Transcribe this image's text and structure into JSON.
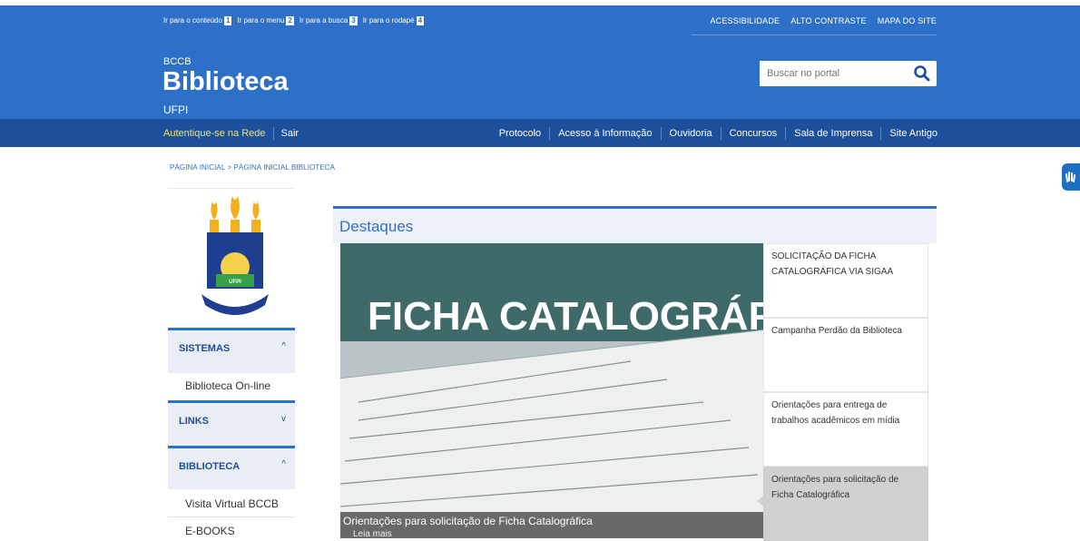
{
  "accessibility_links": [
    {
      "label": "Ir para o conteúdo",
      "num": "1"
    },
    {
      "label": "Ir para o menu",
      "num": "2"
    },
    {
      "label": "Ir para a busca",
      "num": "3"
    },
    {
      "label": "Ir para o rodapé",
      "num": "4"
    }
  ],
  "top_right_links": [
    "ACESSIBILIDADE",
    "ALTO CONTRASTE",
    "MAPA DO SITE"
  ],
  "brand": {
    "sub": "BCCB",
    "title": "Biblioteca",
    "bottom": "UFPI"
  },
  "search": {
    "placeholder": "Buscar no portal"
  },
  "nav_left": {
    "auth": "Autentique-se na Rede",
    "logout": "Sair"
  },
  "nav_right": [
    "Protocolo",
    "Acesso à Informação",
    "Ouvidoria",
    "Concursos",
    "Sala de Imprensa",
    "Site Antigo"
  ],
  "breadcrumb": "PÁGINA INICIAL > PÁGINA INICIAL BIBLIOTECA",
  "sidebar": {
    "sections": [
      {
        "label": "SISTEMAS",
        "chevron": "^"
      },
      {
        "label": "LINKS",
        "chevron": "v"
      },
      {
        "label": "BIBLIOTECA",
        "chevron": "^"
      }
    ],
    "items": [
      "Biblioteca On-line",
      "Visita Virtual BCCB",
      "E-BOOKS"
    ]
  },
  "destaques": {
    "title": "Destaques",
    "feature_banner": "FICHA CATALOGRÁFICA",
    "feature_caption": "Orientações para solicitação de Ficha Catalográfica",
    "feature_more": "Leia mais",
    "news": [
      "SOLICITAÇÃO DA FICHA CATALOGRÁFICA VIA SIGAA",
      "Campanha Perdão da Biblioteca",
      "Orientações para entrega de trabalhos acadêmicos em mídia",
      "Orientações para solicitação de Ficha Catalográfica"
    ]
  },
  "colors": {
    "header": "#2e70c7",
    "navbar": "#1d4f9a",
    "auth_link": "#f5e26b"
  }
}
